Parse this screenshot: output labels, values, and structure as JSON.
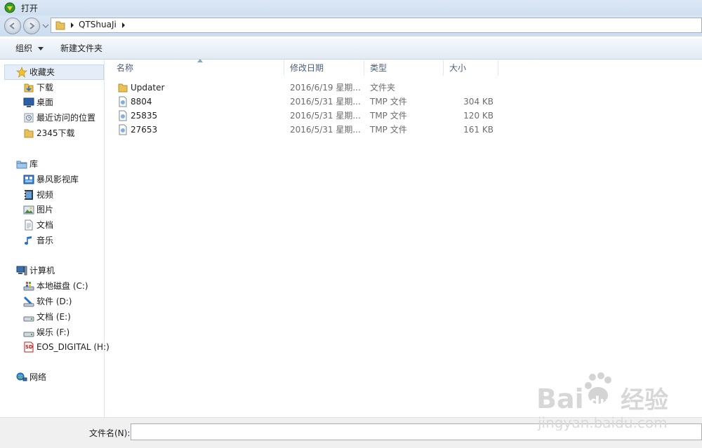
{
  "window": {
    "title": "打开"
  },
  "address": {
    "crumb": "QTShuaJi"
  },
  "toolbar": {
    "organize_label": "组织",
    "new_folder_label": "新建文件夹"
  },
  "sidebar": {
    "groups": [
      {
        "label": "收藏夹",
        "icon": "star-icon",
        "items": [
          {
            "label": "下载",
            "icon": "download-folder-icon"
          },
          {
            "label": "桌面",
            "icon": "desktop-icon"
          },
          {
            "label": "最近访问的位置",
            "icon": "recent-places-icon"
          },
          {
            "label": "2345下载",
            "icon": "folder-icon"
          }
        ]
      },
      {
        "label": "库",
        "icon": "library-icon",
        "items": [
          {
            "label": "暴风影视库",
            "icon": "media-library-icon"
          },
          {
            "label": "视频",
            "icon": "video-icon"
          },
          {
            "label": "图片",
            "icon": "pictures-icon"
          },
          {
            "label": "文档",
            "icon": "documents-icon"
          },
          {
            "label": "音乐",
            "icon": "music-icon"
          }
        ]
      },
      {
        "label": "计算机",
        "icon": "computer-icon",
        "items": [
          {
            "label": "本地磁盘 (C:)",
            "icon": "system-drive-icon"
          },
          {
            "label": "软件 (D:)",
            "icon": "drive-icon"
          },
          {
            "label": "文档 (E:)",
            "icon": "drive-icon"
          },
          {
            "label": "娱乐 (F:)",
            "icon": "drive-icon"
          },
          {
            "label": "EOS_DIGITAL (H:)",
            "icon": "sd-card-icon"
          }
        ]
      },
      {
        "label": "网络",
        "icon": "network-icon",
        "items": []
      }
    ]
  },
  "columns": [
    "名称",
    "修改日期",
    "类型",
    "大小"
  ],
  "files": [
    {
      "name": "Updater",
      "date": "2016/6/19 星期...",
      "type": "文件夹",
      "size": "",
      "icon": "folder-icon"
    },
    {
      "name": "8804",
      "date": "2016/5/31 星期...",
      "type": "TMP 文件",
      "size": "304 KB",
      "icon": "file-icon"
    },
    {
      "name": "25835",
      "date": "2016/5/31 星期...",
      "type": "TMP 文件",
      "size": "120 KB",
      "icon": "file-icon"
    },
    {
      "name": "27653",
      "date": "2016/5/31 星期...",
      "type": "TMP 文件",
      "size": "161 KB",
      "icon": "file-icon"
    }
  ],
  "bottom": {
    "filename_label": "文件名(N):",
    "filename_value": ""
  },
  "watermark": {
    "logo_text": "Bai du 经验",
    "url": "jingyan.baidu.com"
  },
  "colors": {
    "selection": "#e5eef8",
    "header_text": "#4c607a",
    "watermark": "#d7d7d7"
  }
}
